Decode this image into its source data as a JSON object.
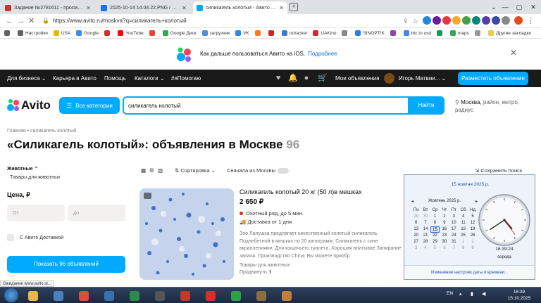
{
  "tabs": [
    {
      "title": "Задание №2781611 - просмотр з",
      "color": "#c0392b"
    },
    {
      "title": "2025-10-14 14.04.22.PNG / Обла",
      "color": "#1a73e8"
    },
    {
      "title": "силикагель колотый - Авито | Об",
      "color": "#00aaff"
    }
  ],
  "address": {
    "url": "https://www.avito.ru/moskva?q=силикагель+колотый"
  },
  "bookmarks": [
    {
      "label": "Настройки",
      "color": "#5f6368"
    },
    {
      "label": "USA",
      "color": "#f0b400"
    },
    {
      "label": "Google",
      "color": "#4285f4"
    },
    {
      "label": "",
      "color": "#d93025"
    },
    {
      "label": "YouTube",
      "color": "#ff0000"
    },
    {
      "label": "",
      "color": "#ea4335"
    },
    {
      "label": "Google Диск",
      "color": "#34a853"
    },
    {
      "label": "загрузчик",
      "color": "#4a90d9"
    },
    {
      "label": "VK",
      "color": "#2787f5"
    },
    {
      "label": "",
      "color": "#ff7a1a"
    },
    {
      "label": "",
      "color": "#cc2a2a"
    },
    {
      "label": "rutracker",
      "color": "#3a7bd5"
    },
    {
      "label": "UAKino",
      "color": "#d62828"
    },
    {
      "label": "",
      "color": "#888888"
    },
    {
      "label": "SINOPTIK",
      "color": "#2b7de9"
    },
    {
      "label": "",
      "color": "#8e44ad"
    },
    {
      "label": "btc to usd",
      "color": "#4285f4"
    },
    {
      "label": "",
      "color": "#0f9d58"
    },
    {
      "label": "maps",
      "color": "#34a853"
    },
    {
      "label": "",
      "color": "#999999"
    }
  ],
  "bookmarks_other": "Другие закладки",
  "banner": {
    "text": "Как дальше пользоваться Авито на iOS.",
    "link": "Подробнее"
  },
  "topnav": {
    "business": "Для бизнеса",
    "career": "Карьера в Авито",
    "help": "Помощь",
    "catalogs": "Каталоги",
    "tag": "#яПомогаю",
    "my_ads": "Мои объявления",
    "user": "Игорь Матвии...",
    "post_ad": "Разместить объявление"
  },
  "logo_text": "Avito",
  "search": {
    "categories_btn": "Все категории",
    "query": "силикагель колотый",
    "find_btn": "Найти",
    "region_city": "Москва,",
    "region_rest": " район, метро, радиус"
  },
  "breadcrumb": "Главная  •  силикагель колотый",
  "title": {
    "main": "«Силикагель колотый»: объявления в Москве",
    "count": "96"
  },
  "filters": {
    "category": "Животные",
    "subcategory": "Товары для животных",
    "price_label": "Цена, ₽",
    "from_placeholder": "От",
    "to_placeholder": "до",
    "delivery": "С Авито Доставкой",
    "show_btn": "Показать 96 объявлений"
  },
  "sorting": {
    "sort": "Сортировка",
    "moscow_first": "Сначала из Москвы",
    "save": "Сохранить поиск"
  },
  "listing": {
    "title": "Силикагель колотый 20 кг (50 л)в мешках",
    "price": "2 650 ₽",
    "location": "Охотный ряд, до 5 мин.",
    "delivery": "Доставка от 1 дня",
    "description": "Зоо Лапушка предлагает качественный колотый силикагель Поднебесной в мешках по 20 килограмм. Силикагель с сине вкраплениями. Для кошачьего туалета. Хорошая впитывае Запирание запаха. Производство China. Вы можете приобр",
    "seller": "Товары для животных",
    "seller2": "Продвинуто"
  },
  "status": "Ожидание www.avito.st...",
  "clock_popup": {
    "full_date": "15 жовтня 2025 р.",
    "month": "Жовтень 2025 р.",
    "weekdays": [
      "Пн",
      "Вт",
      "Ср",
      "Чт",
      "Пт",
      "Сб",
      "Нд"
    ],
    "days": [
      [
        "29",
        "30",
        "1",
        "2",
        "3",
        "4",
        "5"
      ],
      [
        "6",
        "7",
        "8",
        "9",
        "10",
        "11",
        "12"
      ],
      [
        "13",
        "14",
        "15",
        "16",
        "17",
        "18",
        "19"
      ],
      [
        "20",
        "21",
        "22",
        "23",
        "24",
        "25",
        "26"
      ],
      [
        "27",
        "28",
        "29",
        "30",
        "31",
        "1",
        "2"
      ],
      [
        "3",
        "4",
        "5",
        "6",
        "7",
        "8",
        "9"
      ]
    ],
    "today": "15",
    "time": "16:39:24",
    "weekday": "середа",
    "settings_link": "Изменение настроек даты и времени..."
  },
  "tray": {
    "lang": "EN",
    "time": "16:39",
    "date": "15.10.2025"
  },
  "taskbar_icons": [
    {
      "name": "windows-explorer-icon",
      "color": "#e8b84a"
    },
    {
      "name": "security-app-icon",
      "color": "#4a7fc0"
    },
    {
      "name": "chrome-icon",
      "color": "#dd4b39"
    },
    {
      "name": "network-icon",
      "color": "#3a6fb0"
    },
    {
      "name": "spreadsheet-icon",
      "color": "#2d8a4e"
    },
    {
      "name": "unknown-app-icon",
      "color": "#555555"
    },
    {
      "name": "dvd-icon",
      "color": "#c0392b"
    },
    {
      "name": "64-app-icon",
      "color": "#d32f2f"
    },
    {
      "name": "photo-viewer-icon",
      "color": "#2ea043"
    },
    {
      "name": "tool-icon",
      "color": "#8c6d3f"
    },
    {
      "name": "avatar-app-icon",
      "color": "#c77d3a"
    }
  ]
}
